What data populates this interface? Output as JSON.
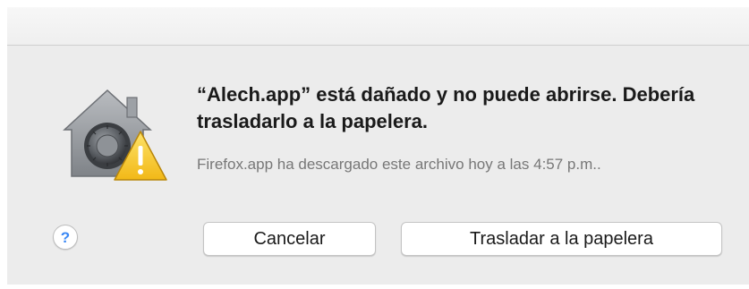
{
  "dialog": {
    "heading": "“Alech.app” está dañado y no puede abrirse. Debería trasladarlo a la papelera.",
    "subtext": "Firefox.app ha descargado este archivo hoy a las 4:57 p.m..",
    "icon": "gatekeeper-lock-warning-icon",
    "help_label": "?",
    "buttons": {
      "cancel": "Cancelar",
      "move_to_trash": "Trasladar a la papelera"
    }
  },
  "colors": {
    "dialog_background": "#ececec",
    "help_accent": "#3a88f5",
    "warning_yellow": "#f5c518"
  }
}
